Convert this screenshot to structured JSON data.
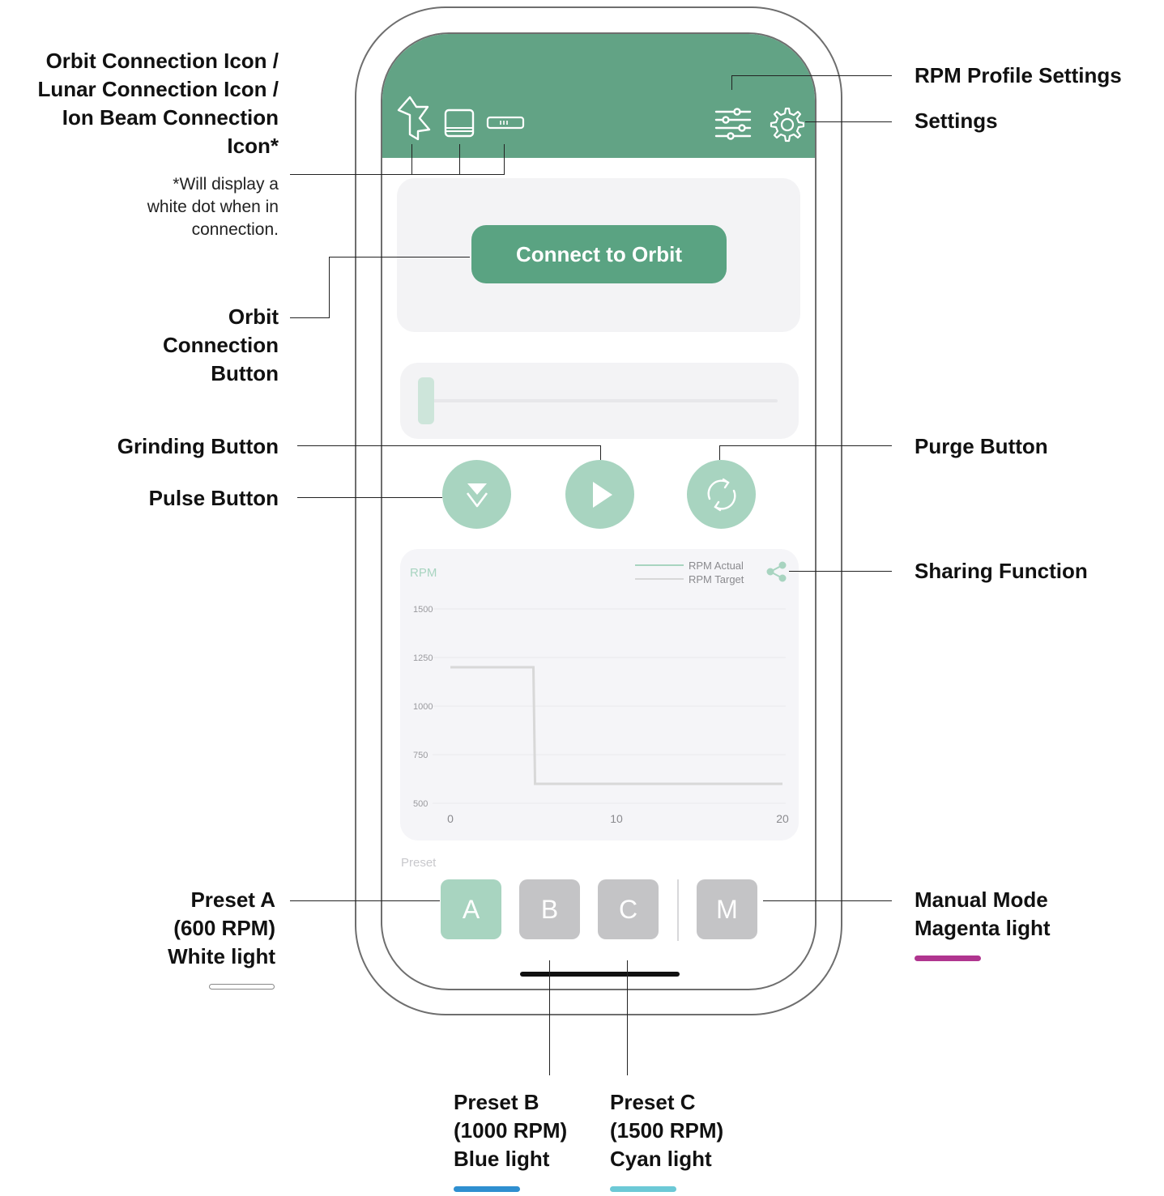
{
  "callouts": {
    "connection_icons": [
      "Orbit Connection Icon /",
      "Lunar Connection Icon /",
      "Ion Beam Connection",
      "Icon*"
    ],
    "connection_note": [
      "*Will display a",
      "white dot when in",
      "connection."
    ],
    "orbit_button": [
      "Orbit",
      "Connection",
      "Button"
    ],
    "grinding": "Grinding Button",
    "pulse": "Pulse Button",
    "preset_a": [
      "Preset A",
      "(600 RPM)",
      "White light"
    ],
    "preset_b": [
      "Preset B",
      "(1000 RPM)",
      "Blue light"
    ],
    "preset_c": [
      "Preset C",
      "(1500 RPM)",
      "Cyan light"
    ],
    "rpm_profile": "RPM Profile Settings",
    "settings": "Settings",
    "purge": "Purge Button",
    "sharing": "Sharing Function",
    "manual": [
      "Manual Mode",
      "Magenta light"
    ]
  },
  "light_colors": {
    "white": "#ffffff",
    "blue": "#2f8fd0",
    "cyan": "#6cc9d6",
    "magenta": "#b0358f"
  },
  "app": {
    "header_color": "#62a385",
    "connect_button": "Connect to Orbit",
    "preset_label": "Preset",
    "presets": [
      "A",
      "B",
      "C",
      "M"
    ],
    "active_preset": "A",
    "slider_value": 0,
    "icons": {
      "connection": [
        "orbit-icon",
        "lunar-icon",
        "ion-beam-icon"
      ],
      "header_right": [
        "rpm-profile-icon",
        "gear-icon"
      ],
      "buttons": [
        "pulse-icon",
        "play-icon",
        "purge-icon"
      ],
      "share": "share-icon"
    }
  },
  "chart_data": {
    "type": "line",
    "ylabel": "RPM",
    "xlabel": "",
    "xlim": [
      0,
      20
    ],
    "ylim": [
      500,
      1500
    ],
    "x_ticks": [
      "0",
      "10",
      "20"
    ],
    "y_ticks": [
      "1500",
      "1250",
      "1000",
      "750",
      "500"
    ],
    "legend": [
      "RPM Actual",
      "RPM Target"
    ],
    "legend_position": "top-right",
    "series": [
      {
        "name": "RPM Target",
        "color": "#d8d8d8",
        "x": [
          0,
          5,
          5.1,
          20
        ],
        "y": [
          1200,
          1200,
          600,
          600
        ]
      }
    ]
  }
}
